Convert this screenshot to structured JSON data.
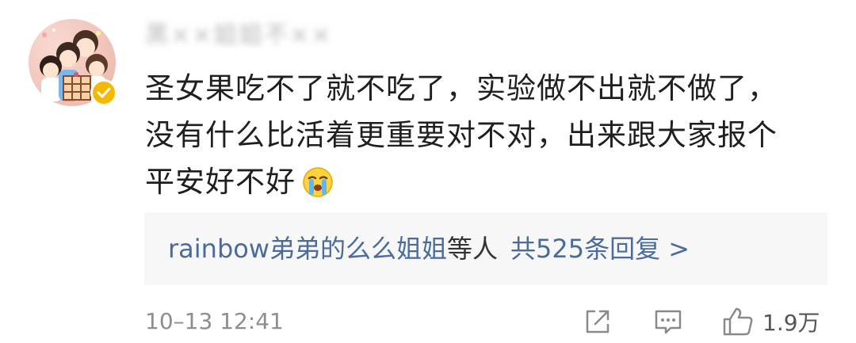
{
  "user": {
    "username": "黑××姐姐不××",
    "verified": true
  },
  "comment": {
    "lines": [
      "圣女果吃不了就不吃了，实验做不出就不做了，",
      "没有什么比活着更重要对不对，出来跟大家报个",
      "平安好不好"
    ],
    "emoji": "crying-face-icon"
  },
  "replies": {
    "names": "rainbow弟弟的么么姐姐",
    "others": "等人",
    "count_text": "共525条回复 >"
  },
  "footer": {
    "timestamp": "10–13 12:41",
    "like_count": "1.9万"
  },
  "colors": {
    "link": "#4a6b9b",
    "badge": "#f5b700",
    "reply_bg": "#f7f7f7"
  }
}
